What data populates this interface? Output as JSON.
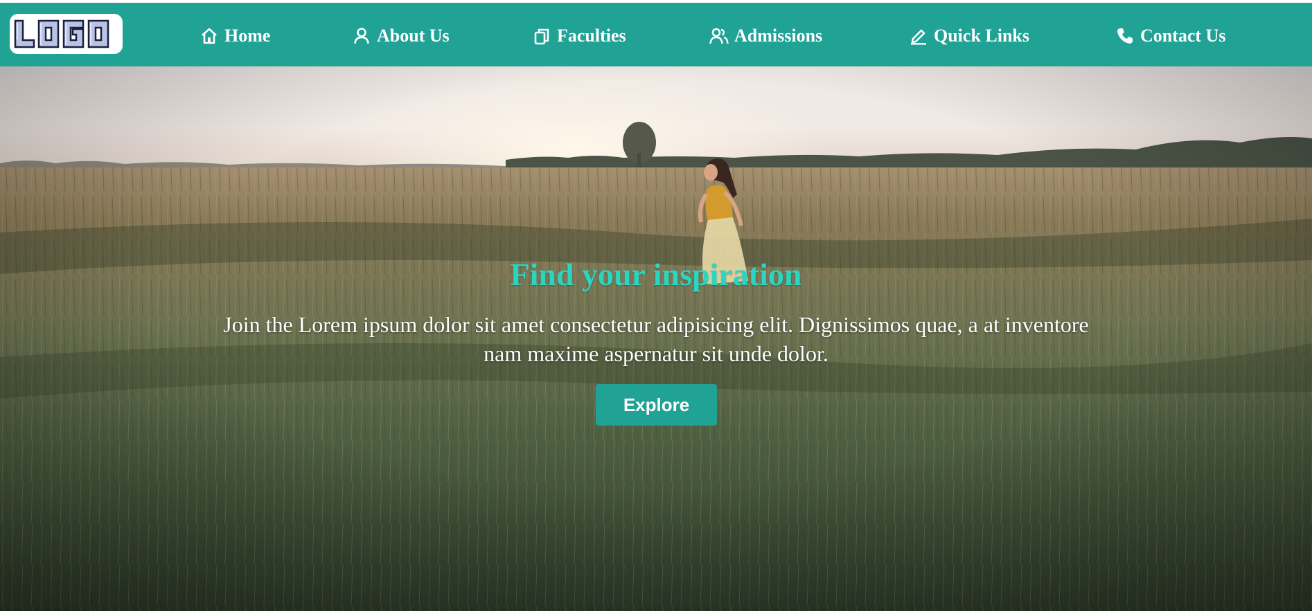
{
  "logo": {
    "text": "LOGO"
  },
  "nav": {
    "items": [
      {
        "label": "Home",
        "icon": "home-icon"
      },
      {
        "label": "About Us",
        "icon": "user-icon"
      },
      {
        "label": "Faculties",
        "icon": "copy-icon"
      },
      {
        "label": "Admissions",
        "icon": "users-icon"
      },
      {
        "label": "Quick Links",
        "icon": "pen-icon"
      },
      {
        "label": "Contact Us",
        "icon": "phone-icon"
      }
    ]
  },
  "hero": {
    "title": "Find your inspiration",
    "text": "Join the Lorem ipsum dolor sit amet consectetur adipisicing elit. Dignissimos quae, a at inventore nam maxime aspernatur sit unde dolor.",
    "button_label": "Explore",
    "background": "woman-in-wheat-field-photo"
  },
  "colors": {
    "accent": "#20a295",
    "title": "#2ad6c2",
    "text": "#ffffff"
  }
}
